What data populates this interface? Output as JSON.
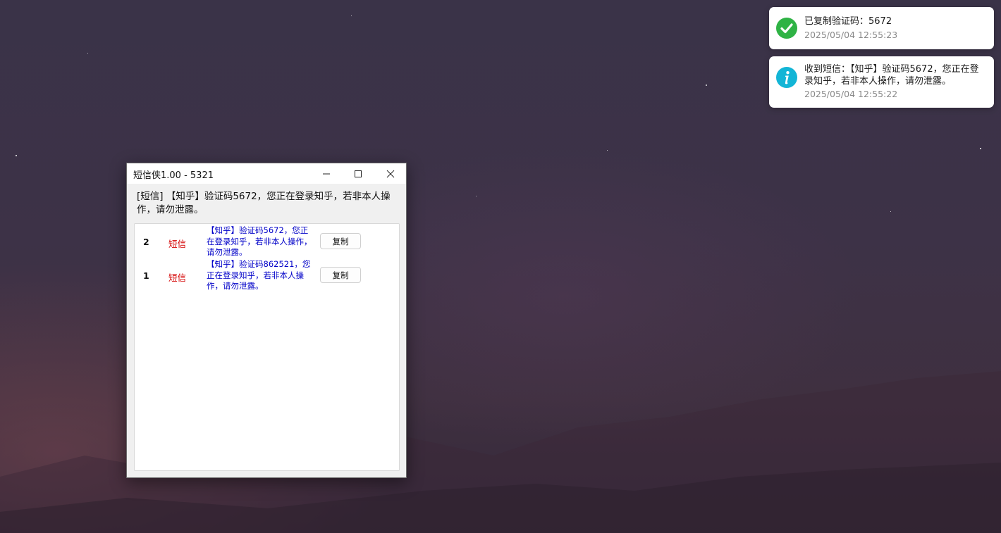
{
  "window": {
    "title": "短信侠1.00 - 5321",
    "status_text": "[短信] 【知乎】验证码5672，您正在登录知乎，若非本人操作，请勿泄露。",
    "controls": [
      "minimize-icon",
      "maximize-icon",
      "close-icon"
    ]
  },
  "messages": [
    {
      "index": "2",
      "type": "短信",
      "content": "【知乎】验证码5672，您正在登录知乎，若非本人操作，请勿泄露。",
      "button": "复制"
    },
    {
      "index": "1",
      "type": "短信",
      "content": "【知乎】验证码862521，您正在登录知乎，若非本人操作，请勿泄露。",
      "button": "复制"
    }
  ],
  "notifications": [
    {
      "icon": "check-icon",
      "title": "已复制验证码：5672",
      "time": "2025/05/04 12:55:23",
      "color": "#2fb345"
    },
    {
      "icon": "info-icon",
      "title": "收到短信：【知乎】验证码5672，您正在登录知乎，若非本人操作，请勿泄露。",
      "time": "2025/05/04 12:55:22",
      "color": "#13b5d6"
    }
  ],
  "colors": {
    "type_label": "#d40000",
    "message_text": "#0000c8"
  }
}
